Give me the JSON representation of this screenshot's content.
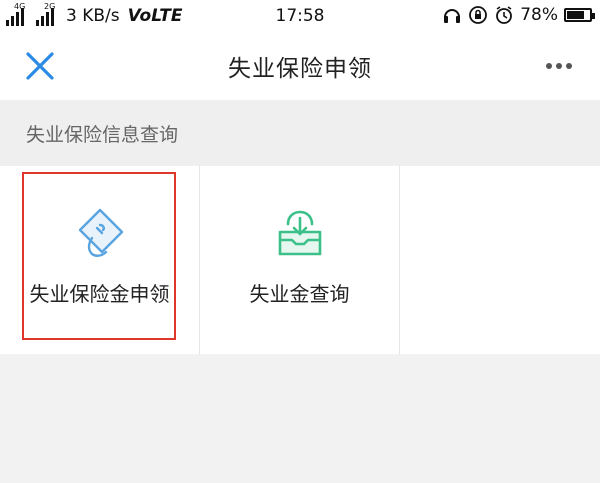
{
  "status_bar": {
    "net_speed": "3 KB/s",
    "network_type": "VoLTE",
    "signal1_label": "4G",
    "signal2_label": "2G",
    "time": "17:58",
    "battery": "78%",
    "battery_level": 0.78
  },
  "nav": {
    "title": "失业保险申领",
    "close_icon": "close-icon",
    "more_icon": "more-icon"
  },
  "section": {
    "title": "失业保险信息查询"
  },
  "services": [
    {
      "label": "失业保险金申领",
      "icon": "hand-card-icon",
      "selected": true,
      "color": "#5aa4e0"
    },
    {
      "label": "失业金查询",
      "icon": "tray-download-icon",
      "selected": false,
      "color": "#3cc08a"
    },
    {
      "label": "",
      "icon": "",
      "selected": false
    }
  ]
}
